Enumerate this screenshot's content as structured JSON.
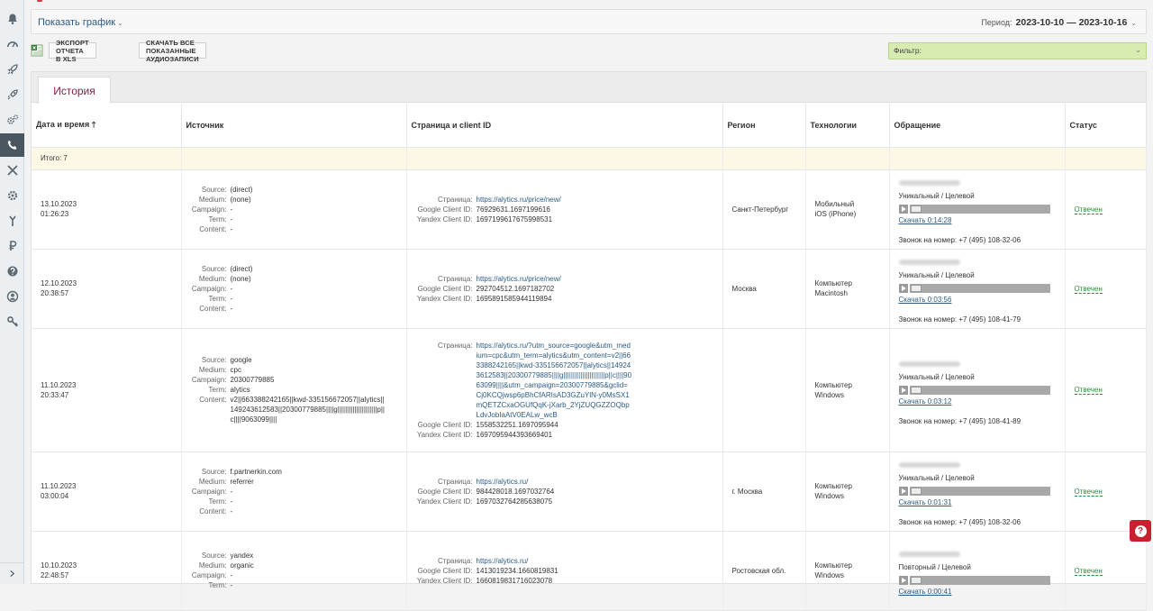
{
  "header": {
    "show_graph": "Показать график",
    "period_label": "Период:",
    "period_value": "2023-10-10 — 2023-10-16"
  },
  "toolbar": {
    "export_xls": "ЭКСПОРТ ОТЧЕТА В XLS",
    "download_audio": "СКАЧАТЬ ВСЕ ПОКАЗАННЫЕ АУДИОЗАПИСИ"
  },
  "filter": {
    "label": "Фильтр:"
  },
  "tabs": {
    "history": "История"
  },
  "table": {
    "headers": {
      "datetime": "Дата и время",
      "source": "Источник",
      "page": "Страница и client ID",
      "region": "Регион",
      "tech": "Технологии",
      "appeal": "Обращение",
      "status": "Статус"
    },
    "total": "Итого: 7",
    "labels": {
      "source": "Source:",
      "medium": "Medium:",
      "campaign": "Campaign:",
      "term": "Term:",
      "content": "Content:",
      "page": "Страница:",
      "gcid": "Google Client ID:",
      "ycid": "Yandex Client ID:"
    },
    "rows": [
      {
        "date": "13.10.2023",
        "time": "01:26:23",
        "source": "(direct)",
        "medium": "(none)",
        "campaign": "-",
        "term": "-",
        "content": "-",
        "page": "https://alytics.ru/price/new/",
        "gcid": "76929631.1697199616",
        "ycid": "1697199617675998531",
        "region": "Санкт-Петербург",
        "tech1": "Мобильный",
        "tech2": "iOS (iPhone)",
        "visit_type": "Уникальный / Целевой",
        "download": "Скачать 0:14:28",
        "call_to": "Звонок на номер: +7 (495) 108-32-06",
        "status": "Отвечен"
      },
      {
        "date": "12.10.2023",
        "time": "20:38:57",
        "source": "(direct)",
        "medium": "(none)",
        "campaign": "-",
        "term": "-",
        "content": "-",
        "page": "https://alytics.ru/price/new/",
        "gcid": "292704512.1697182702",
        "ycid": "1695891585944119894",
        "region": "Москва",
        "tech1": "Компьютер",
        "tech2": "Macintosh",
        "visit_type": "Уникальный / Целевой",
        "download": "Скачать 0:03:56",
        "call_to": "Звонок на номер: +7 (495) 108-41-79",
        "status": "Отвечен"
      },
      {
        "date": "11.10.2023",
        "time": "20:33:47",
        "source": "google",
        "medium": "cpc",
        "campaign": "20300779885",
        "term": "alytics",
        "content": "v2||663388242165||kwd-335156672057||alytics||149243612583||20300779885||||g|||||||||||||||||||||p||c||||9063099||||",
        "page": "https://alytics.ru/?utm_source=google&utm_medium=cpc&utm_term=alytics&utm_content=v2||663388242165||kwd-335156672057||alytics||149243612583||20300779885||||g||||||||||||||||||||||p||c||||9063099||||&utm_campaign=20300779885&gclid=Cj0KCQjwsp6pBhCfARIsAD3GZuYlN-y0MsSX1mQETZCxaOGUfQqK-jXarb_2YjZUQGZZOQbpLdvJobIaAtV0EALw_wcB",
        "gcid": "1558532251.1697095944",
        "ycid": "1697095944393669401",
        "region": "",
        "tech1": "Компьютер",
        "tech2": "Windows",
        "visit_type": "Уникальный / Целевой",
        "download": "Скачать 0:03:12",
        "call_to": "Звонок на номер: +7 (495) 108-41-89",
        "status": "Отвечен"
      },
      {
        "date": "11.10.2023",
        "time": "03:00:04",
        "source": "f.partnerkin.com",
        "medium": "referrer",
        "campaign": "-",
        "term": "-",
        "content": "-",
        "page": "https://alytics.ru/",
        "gcid": "984428018.1697032764",
        "ycid": "1697032764285638075",
        "region": "г. Москва",
        "tech1": "Компьютер",
        "tech2": "Windows",
        "visit_type": "Уникальный / Целевой",
        "download": "Скачать 0:01:31",
        "call_to": "Звонок на номер: +7 (495) 108-32-06",
        "status": "Отвечен"
      },
      {
        "date": "10.10.2023",
        "time": "22:48:57",
        "source": "yandex",
        "medium": "organic",
        "campaign": "-",
        "term": "-",
        "content": "",
        "page": "https://alytics.ru/",
        "gcid": "1413019234.1660819831",
        "ycid": "1660819831716023078",
        "region": "Ростовская обл.",
        "tech1": "Компьютер",
        "tech2": "Windows",
        "visit_type": "Повторный / Целевой",
        "download": "Скачать 0:00:41",
        "call_to": "",
        "status": "Отвечен"
      }
    ]
  },
  "colors": {
    "accent_link": "#2b5b84",
    "status_green": "#2e8b3c",
    "filter_bg": "#d7ecb0",
    "help_red": "#c8202f"
  }
}
